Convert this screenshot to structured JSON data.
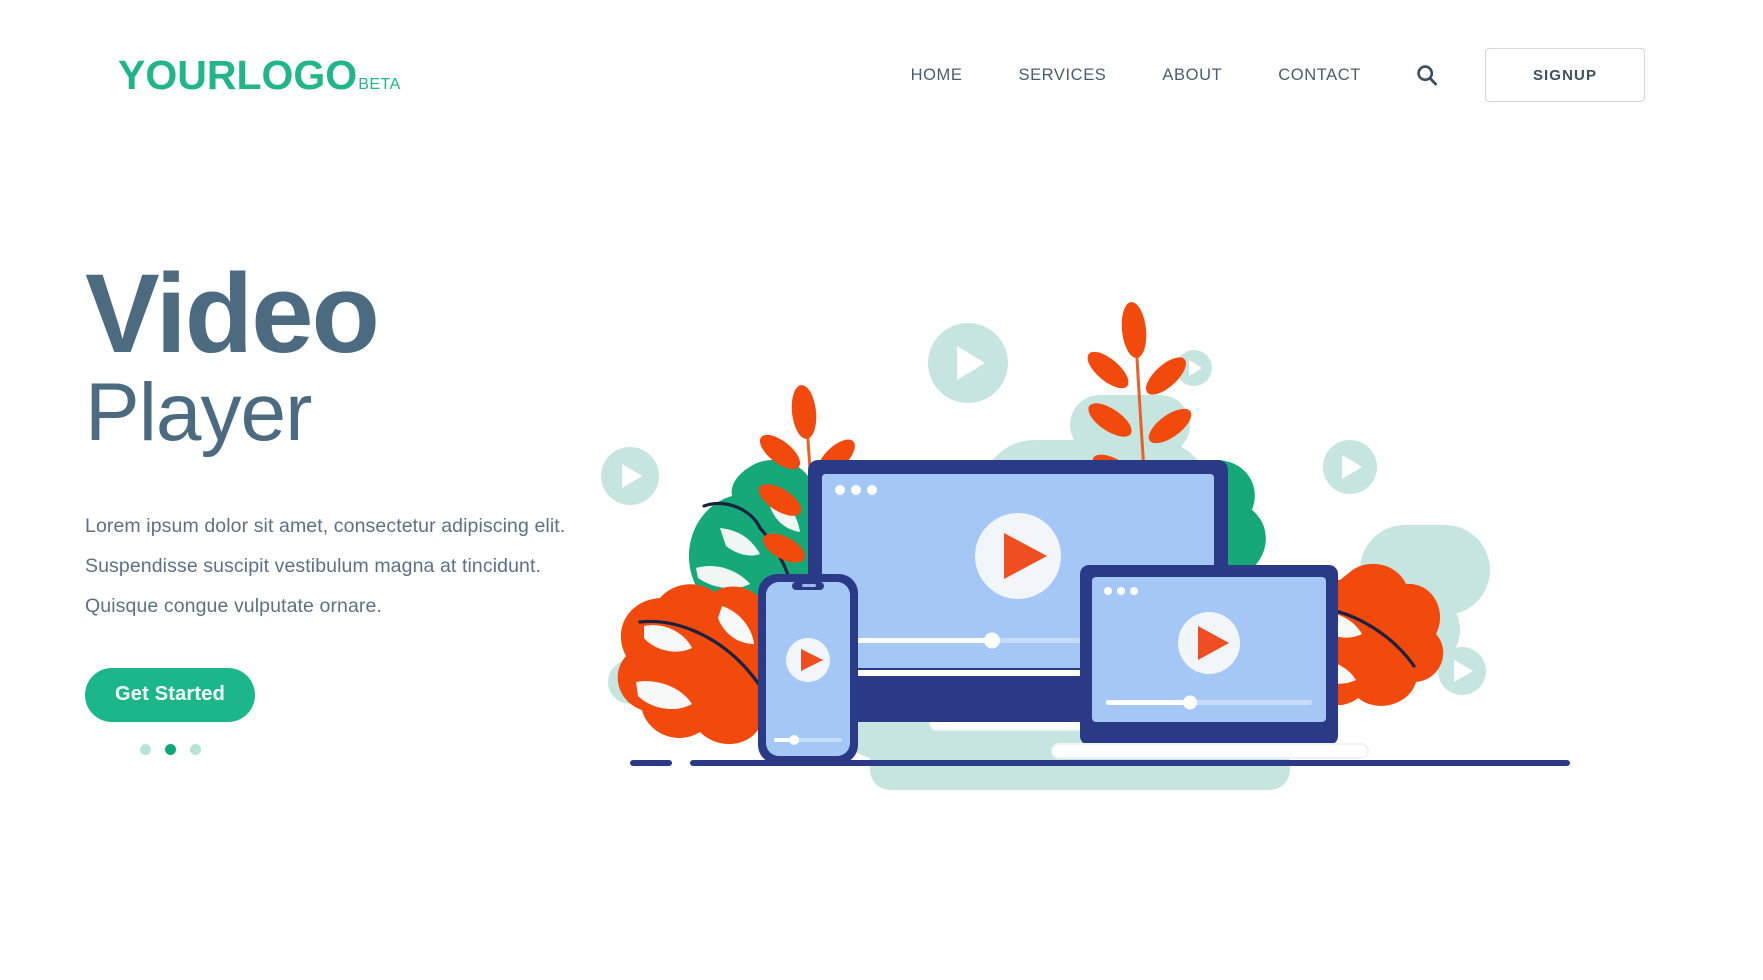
{
  "brand": {
    "logo_main": "YOURLOGO",
    "logo_beta": "BETA",
    "accent_green": "#21b58b",
    "heading_slate": "#4c6a80",
    "cta_green": "#1bb68a",
    "play_orange": "#f04d20",
    "device_navy": "#2b3a86",
    "screen_blue": "#a5c7f5",
    "leaf_green": "#17a879",
    "mint": "#bfe3dd"
  },
  "header": {
    "nav": [
      {
        "label": "HOME"
      },
      {
        "label": "SERVICES"
      },
      {
        "label": "ABOUT"
      },
      {
        "label": "CONTACT"
      }
    ],
    "search_icon": "search-icon",
    "signup_label": "SIGNUP"
  },
  "hero": {
    "title_line1": "Video",
    "title_line2": "Player",
    "paragraph_lines": [
      "Lorem ipsum dolor sit amet, consectetur adipiscing elit.",
      "Suspendisse suscipit vestibulum magna at tincidunt.",
      "Quisque congue vulputate ornare."
    ],
    "cta_label": "Get Started",
    "carousel": {
      "count": 3,
      "active_index": 1
    }
  },
  "illustration": {
    "name": "video-player-devices-illustration",
    "devices": [
      {
        "name": "desktop-monitor",
        "play_button": "play-icon",
        "window_dots": 3,
        "progress_percent": 42
      },
      {
        "name": "laptop",
        "play_button": "play-icon",
        "window_dots": 3,
        "progress_percent": 40
      },
      {
        "name": "smartphone",
        "play_button": "play-icon",
        "progress_percent": 30
      }
    ],
    "decorations": [
      "mint-play-circle",
      "mint-play-circle",
      "mint-play-circle",
      "mint-play-circle",
      "mint-play-circle",
      "orange-leaf-branch",
      "orange-leaf-branch",
      "green-leaf-blob",
      "orange-oak-leaf",
      "mint-rounded-blob"
    ]
  }
}
